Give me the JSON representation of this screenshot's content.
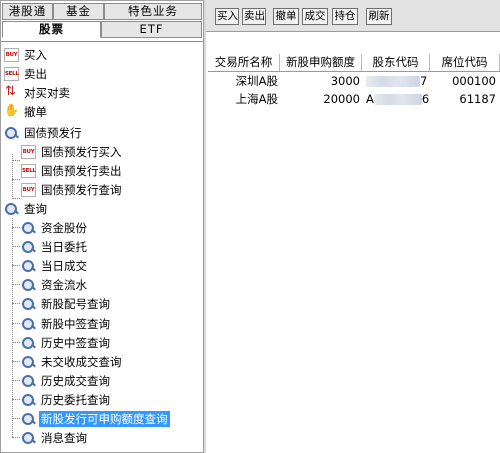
{
  "tabs_row1": [
    {
      "label": "港股通"
    },
    {
      "label": "基金"
    },
    {
      "label": "特色业务"
    }
  ],
  "tabs_row2": [
    {
      "label": "股票"
    },
    {
      "label": "ETF"
    }
  ],
  "tree": {
    "buy": "买入",
    "sell": "卖出",
    "buy_sell": "对买对卖",
    "cancel": "撤单",
    "bond_presale": "国债预发行",
    "bond_presale_buy": "国债预发行买入",
    "bond_presale_sell": "国债预发行卖出",
    "bond_presale_query": "国债预发行查询",
    "query": "查询",
    "q_funds_shares": "资金股份",
    "q_today_orders": "当日委托",
    "q_today_trades": "当日成交",
    "q_fund_flow": "资金流水",
    "q_ipo_allot": "新股配号查询",
    "q_ipo_win": "新股中签查询",
    "q_hist_win": "历史中签查询",
    "q_unsettled": "未交收成交查询",
    "q_hist_trades": "历史成交查询",
    "q_hist_orders": "历史委托查询",
    "q_ipo_quota": "新股发行可申购额度查询",
    "q_messages": "消息查询"
  },
  "icons": {
    "buy": "buy-badge-icon",
    "sell": "sell-badge-icon",
    "query": "magnifier-icon"
  },
  "icon_text": {
    "buy": "BUY",
    "sell": "SELL"
  },
  "toolbar": {
    "buy": "买入",
    "sell": "卖出",
    "cancel": "撤单",
    "trades": "成交",
    "positions": "持仓",
    "refresh": "刷新"
  },
  "grid": {
    "headers": [
      "交易所名称",
      "新股申购额度",
      "股东代码",
      "席位代码"
    ],
    "rows": [
      {
        "exchange": "深圳A股",
        "quota": "3000",
        "holder_suffix": "7",
        "seat": "000100"
      },
      {
        "exchange": "上海A股",
        "quota": "20000",
        "holder_prefix": "A",
        "holder_suffix": "6",
        "seat": "61187"
      }
    ]
  },
  "colors": {
    "selection": "#3399ff",
    "icon_red": "#d01010",
    "panel_bg": "#d9d9d9"
  }
}
